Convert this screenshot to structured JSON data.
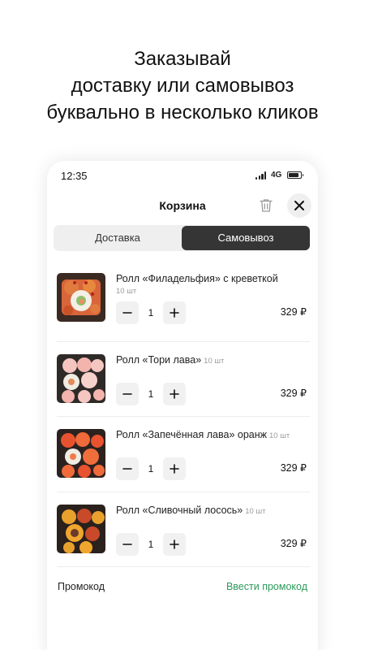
{
  "headline": {
    "line1": "Заказывай",
    "line2": "доставку или самовывоз",
    "line3": "буквально в несколько кликов"
  },
  "status_bar": {
    "time": "12:35",
    "network": "4G"
  },
  "cart": {
    "title": "Корзина",
    "tabs": [
      {
        "label": "Доставка",
        "active": false
      },
      {
        "label": "Самовывоз",
        "active": true
      }
    ],
    "items": [
      {
        "name": "Ролл «Филадельфия» с креветкой",
        "count": "10 шт",
        "quantity": "1",
        "price": "329 ₽"
      },
      {
        "name": "Ролл «Тори лава»",
        "count": "10 шт",
        "quantity": "1",
        "price": "329 ₽"
      },
      {
        "name": "Ролл «Запечённая лава» оранж",
        "count": "10 шт",
        "quantity": "1",
        "price": "329 ₽"
      },
      {
        "name": "Ролл «Сливочный лосось»",
        "count": "10 шт",
        "quantity": "1",
        "price": "329 ₽"
      }
    ],
    "promo_label": "Промокод",
    "promo_link": "Ввести промокод"
  },
  "colors": {
    "accent_green": "#2c9a5b",
    "active_tab": "#353535"
  }
}
